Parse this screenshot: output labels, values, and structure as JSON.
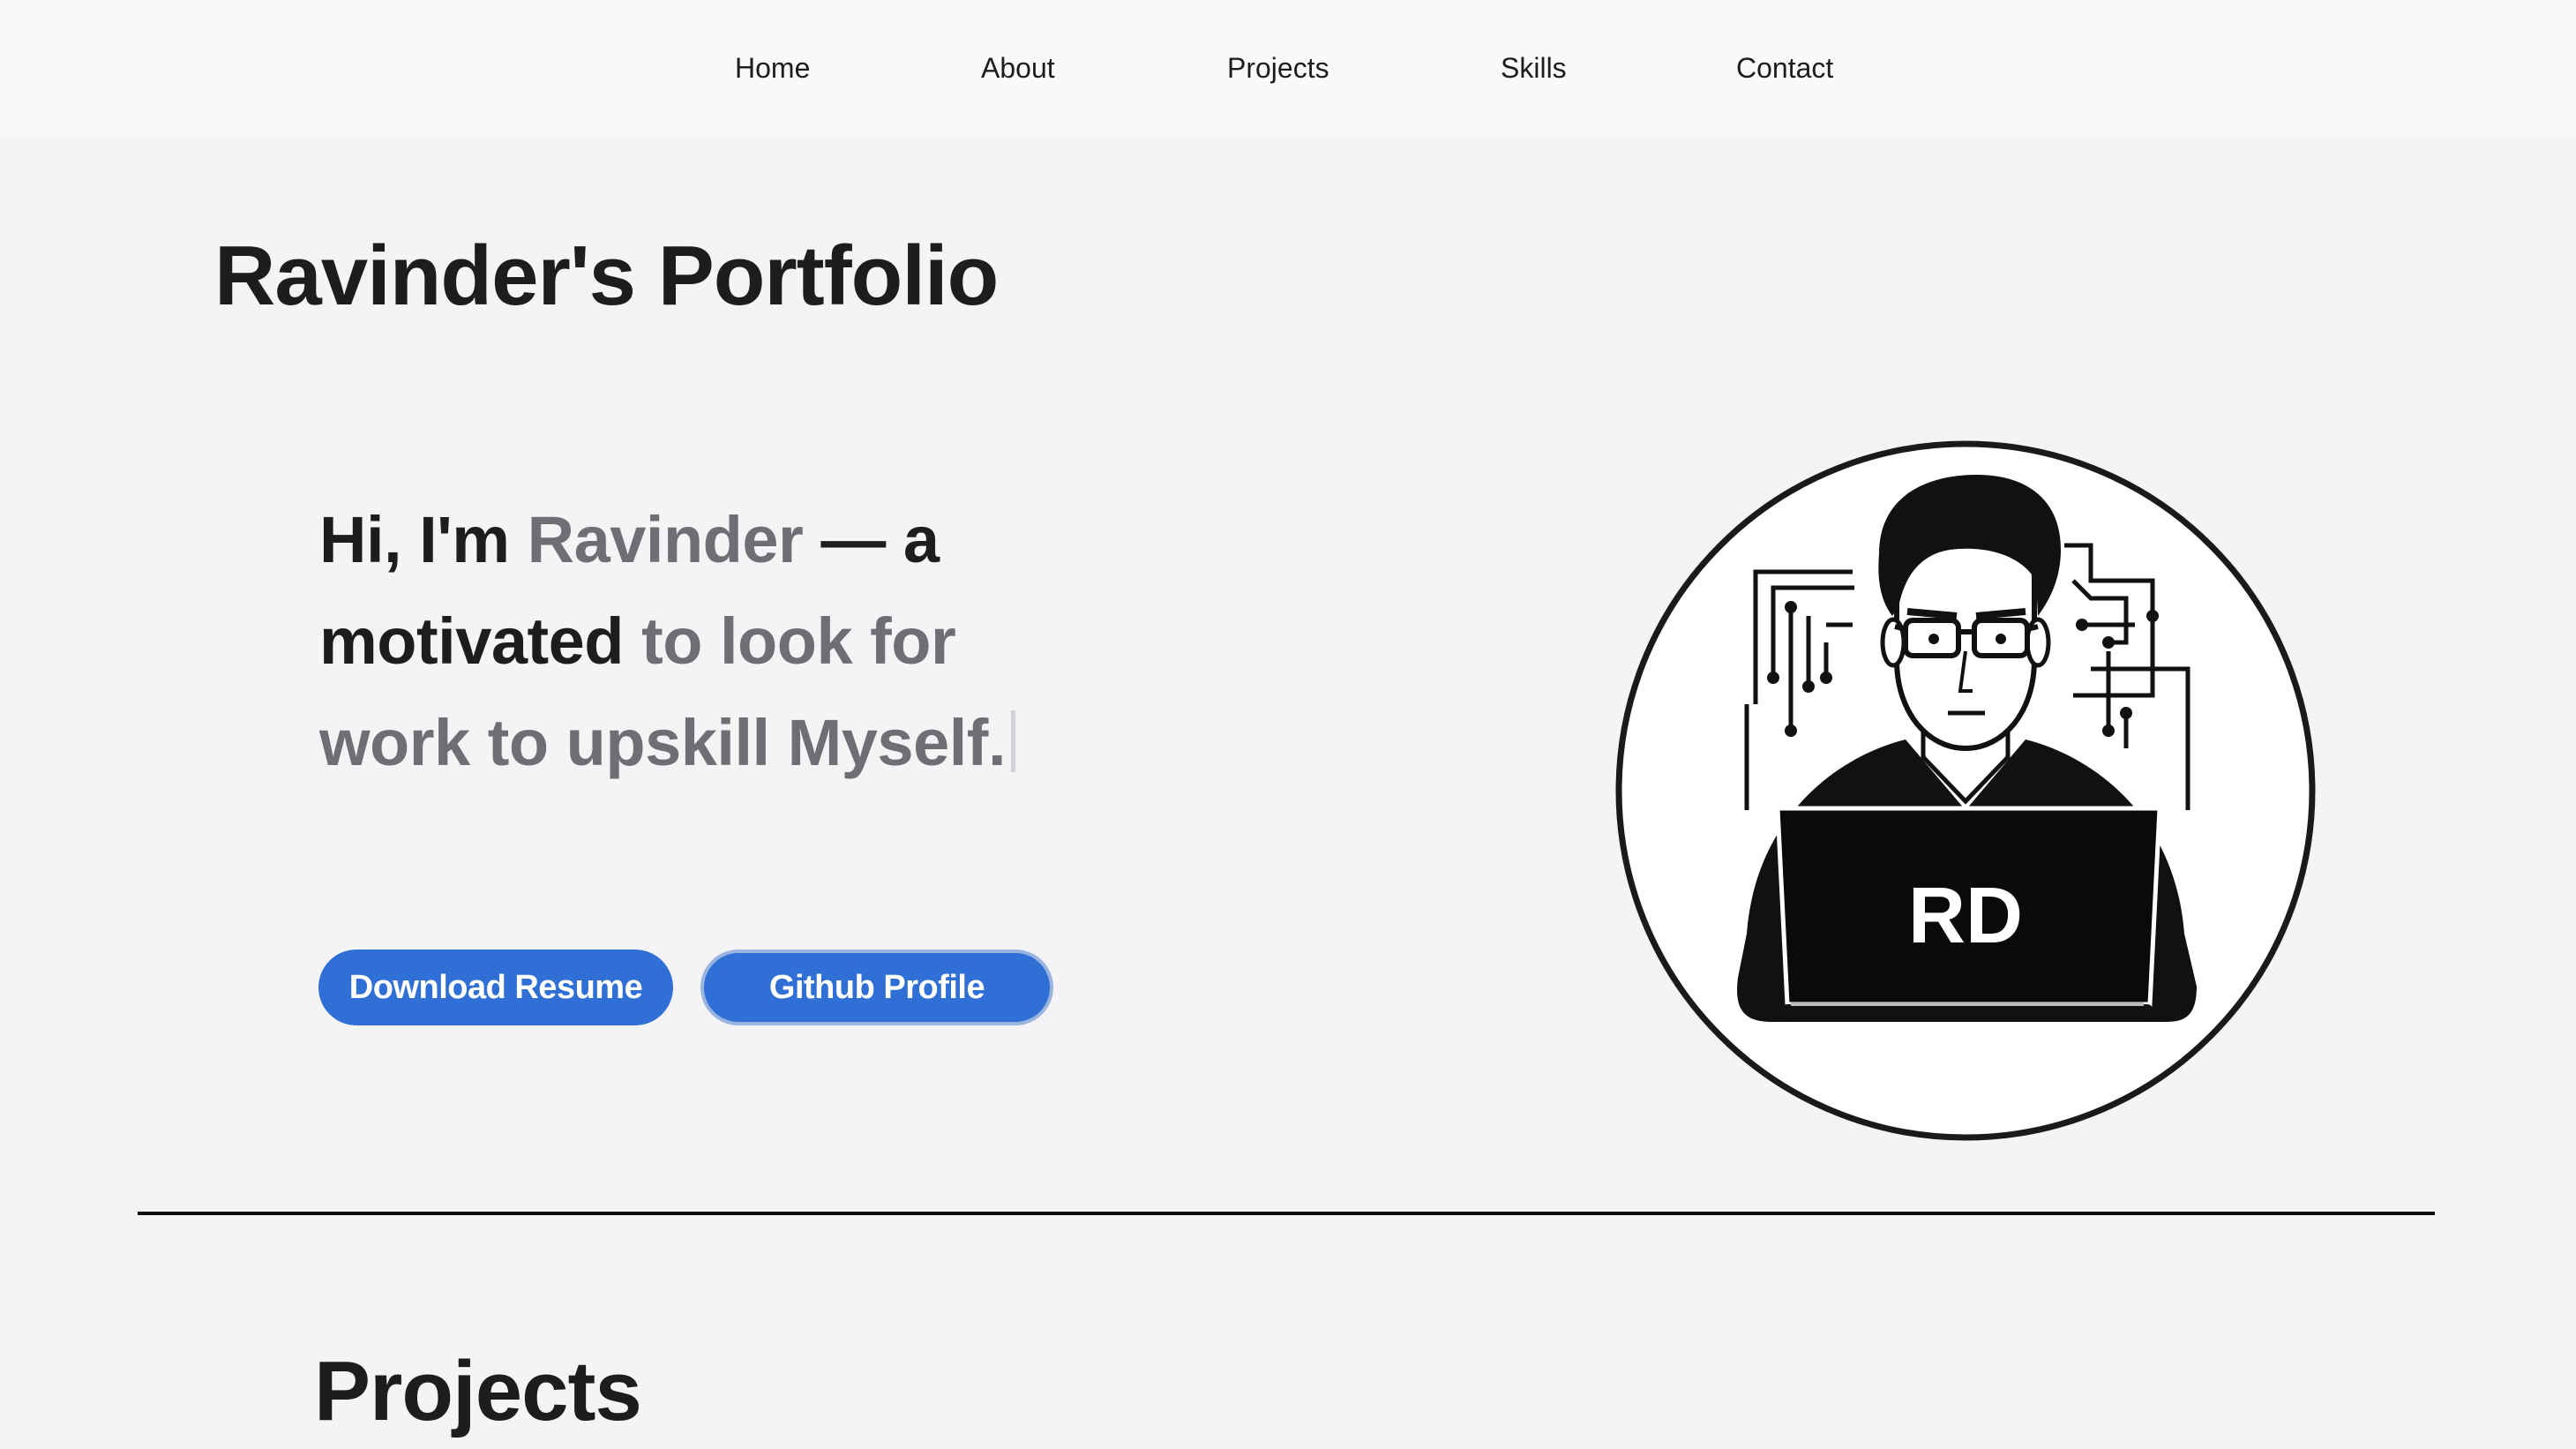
{
  "nav": {
    "home": "Home",
    "about": "About",
    "projects": "Projects",
    "skills": "Skills",
    "contact": "Contact"
  },
  "page_title": "Ravinder's Portfolio",
  "hero": {
    "greeting": "Hi, I'm ",
    "name": "Ravinder",
    "dash": " — a",
    "word_motivated": "motivated",
    "typed_text": " to look for work to upskill Myself."
  },
  "buttons": {
    "resume": "Download Resume",
    "github": "Github Profile"
  },
  "avatar": {
    "initials": "RD",
    "icon": "developer-avatar-icon"
  },
  "sections": {
    "projects_title": "Projects"
  },
  "colors": {
    "background": "#f4f4f6",
    "nav_background": "#f9f9fb",
    "accent": "#2f6fd6",
    "text_dark": "#1d1d1f",
    "text_muted": "#6e6e73"
  }
}
